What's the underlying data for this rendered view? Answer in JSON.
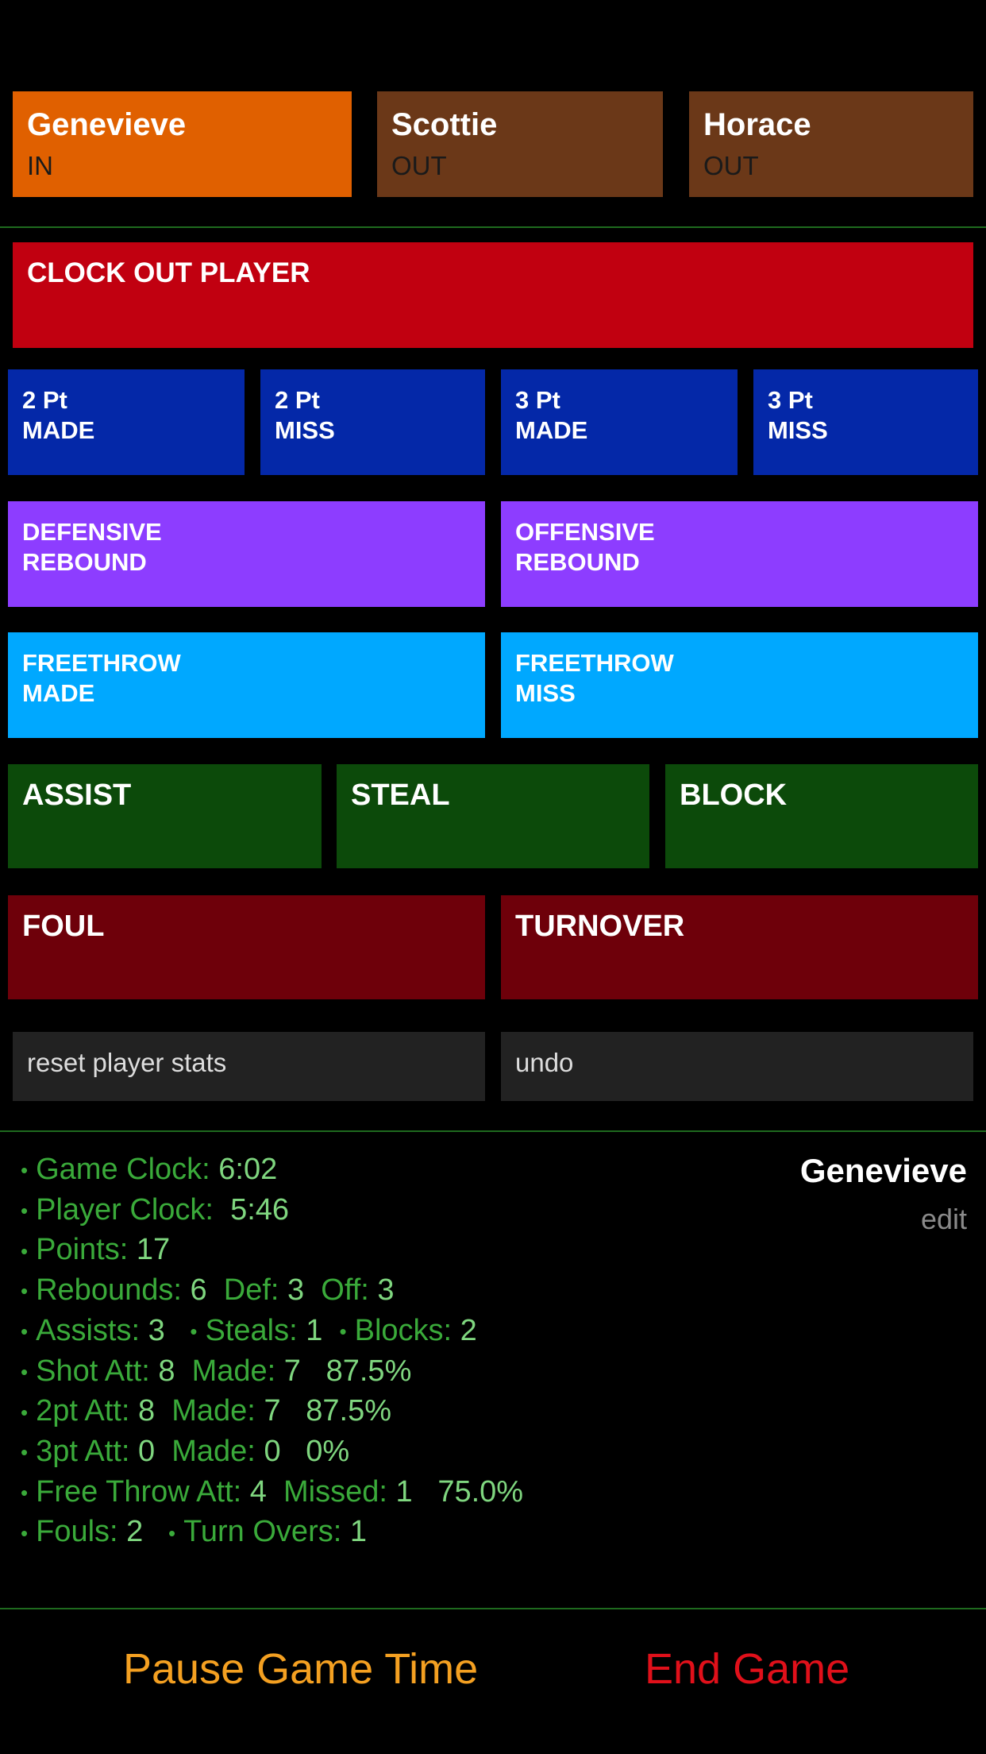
{
  "players": [
    {
      "name": "Genevieve",
      "status": "IN"
    },
    {
      "name": "Scottie",
      "status": "OUT"
    },
    {
      "name": "Horace",
      "status": "OUT"
    }
  ],
  "actions": {
    "clock_out": "CLOCK OUT PLAYER",
    "two_made": [
      "2 Pt",
      "MADE"
    ],
    "two_miss": [
      "2 Pt",
      "MISS"
    ],
    "three_made": [
      "3 Pt",
      "MADE"
    ],
    "three_miss": [
      "3 Pt",
      "MISS"
    ],
    "def_rebound": [
      "DEFENSIVE",
      "REBOUND"
    ],
    "off_rebound": [
      "OFFENSIVE",
      "REBOUND"
    ],
    "ft_made": [
      "FREETHROW",
      "MADE"
    ],
    "ft_miss": [
      "FREETHROW",
      "MISS"
    ],
    "assist": "ASSIST",
    "steal": "STEAL",
    "block": "BLOCK",
    "foul": "FOUL",
    "turnover": "TURNOVER",
    "reset": "reset player stats",
    "undo": "undo"
  },
  "selected": {
    "name": "Genevieve",
    "edit": "edit"
  },
  "stats": {
    "game_clock_label": "Game Clock:",
    "game_clock": "6:02",
    "player_clock_label": "Player Clock:",
    "player_clock": "5:46",
    "points_label": "Points:",
    "points": "17",
    "rebounds_label": "Rebounds:",
    "rebounds": "6",
    "def_label": "Def:",
    "def": "3",
    "off_label": "Off:",
    "off": "3",
    "assists_label": "Assists:",
    "assists": "3",
    "steals_label": "Steals:",
    "steals": "1",
    "blocks_label": "Blocks:",
    "blocks": "2",
    "shot_att_label": "Shot Att:",
    "shot_att": "8",
    "shot_made_label": "Made:",
    "shot_made": "7",
    "shot_pct": "87.5%",
    "pt2_att_label": "2pt Att:",
    "pt2_att": "8",
    "pt2_made_label": "Made:",
    "pt2_made": "7",
    "pt2_pct": "87.5%",
    "pt3_att_label": "3pt Att:",
    "pt3_att": "0",
    "pt3_made_label": "Made:",
    "pt3_made": "0",
    "pt3_pct": "0%",
    "ft_att_label": "Free Throw Att:",
    "ft_att": "4",
    "ft_missed_label": "Missed:",
    "ft_missed": "1",
    "ft_pct": "75.0%",
    "fouls_label": "Fouls:",
    "fouls": "2",
    "turnovers_label": "Turn Overs:",
    "turnovers": "1"
  },
  "bottom": {
    "pause": "Pause Game Time",
    "end": "End Game"
  },
  "colors": {
    "pause": "#f4a021",
    "end": "#e0101a",
    "stat_label": "#3aaa3a",
    "stat_value": "#7fd67f"
  }
}
